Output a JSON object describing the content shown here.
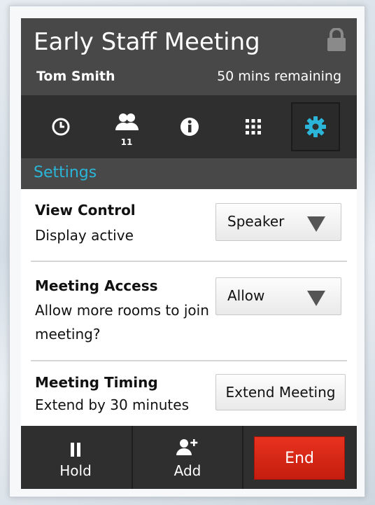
{
  "meeting": {
    "title": "Early Staff Meeting",
    "host": "Tom Smith",
    "remaining": "50 mins remaining",
    "locked": true
  },
  "toolbar": {
    "items": [
      {
        "icon": "clock-icon",
        "label": ""
      },
      {
        "icon": "participants-icon",
        "count": "11"
      },
      {
        "icon": "info-icon"
      },
      {
        "icon": "keypad-icon"
      },
      {
        "icon": "gear-icon",
        "active": true
      }
    ]
  },
  "section": {
    "title": "Settings"
  },
  "settings": {
    "view_control": {
      "label": "View Control",
      "description": "Display active",
      "value": "Speaker"
    },
    "meeting_access": {
      "label": "Meeting Access",
      "description": "Allow more rooms to join meeting?",
      "value": "Allow"
    },
    "meeting_timing": {
      "label": "Meeting Timing",
      "description": "Extend by 30 minutes",
      "button": "Extend Meeting"
    }
  },
  "footer": {
    "hold_label": "Hold",
    "add_label": "Add",
    "end_label": "End"
  },
  "colors": {
    "accent": "#2bb5d9",
    "end_red": "#d9281a",
    "header_bg": "#484848",
    "toolbar_bg": "#2f2f2f"
  }
}
